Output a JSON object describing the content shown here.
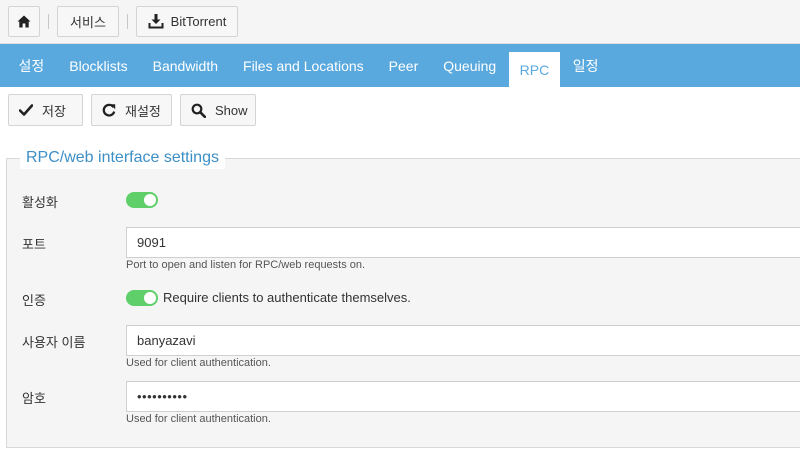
{
  "breadcrumb": {
    "home_icon": "home-icon",
    "service_label": "서비스",
    "app_icon": "download-tray-icon",
    "app_label": "BitTorrent"
  },
  "tabs": [
    {
      "label": "설정",
      "active": false
    },
    {
      "label": "Blocklists",
      "active": false
    },
    {
      "label": "Bandwidth",
      "active": false
    },
    {
      "label": "Files and Locations",
      "active": false
    },
    {
      "label": "Peer",
      "active": false
    },
    {
      "label": "Queuing",
      "active": false
    },
    {
      "label": "RPC",
      "active": true
    },
    {
      "label": "일정",
      "active": false
    }
  ],
  "toolbar": {
    "save_label": "저장",
    "reset_label": "재설정",
    "show_label": "Show"
  },
  "section": {
    "legend": "RPC/web interface settings"
  },
  "fields": {
    "enable": {
      "label": "활성화",
      "on": true
    },
    "port": {
      "label": "포트",
      "value": "9091",
      "hint": "Port to open and listen for RPC/web requests on."
    },
    "auth": {
      "label": "인증",
      "on": true,
      "text": "Require clients to authenticate themselves."
    },
    "username": {
      "label": "사용자 이름",
      "value": "banyazavi",
      "hint": "Used for client authentication."
    },
    "password": {
      "label": "암호",
      "value": "••••••••••",
      "hint": "Used for client authentication."
    }
  },
  "colors": {
    "tab_bar": "#5aa9de",
    "toggle_on": "#5fcf6a",
    "legend": "#3d8fc6"
  }
}
